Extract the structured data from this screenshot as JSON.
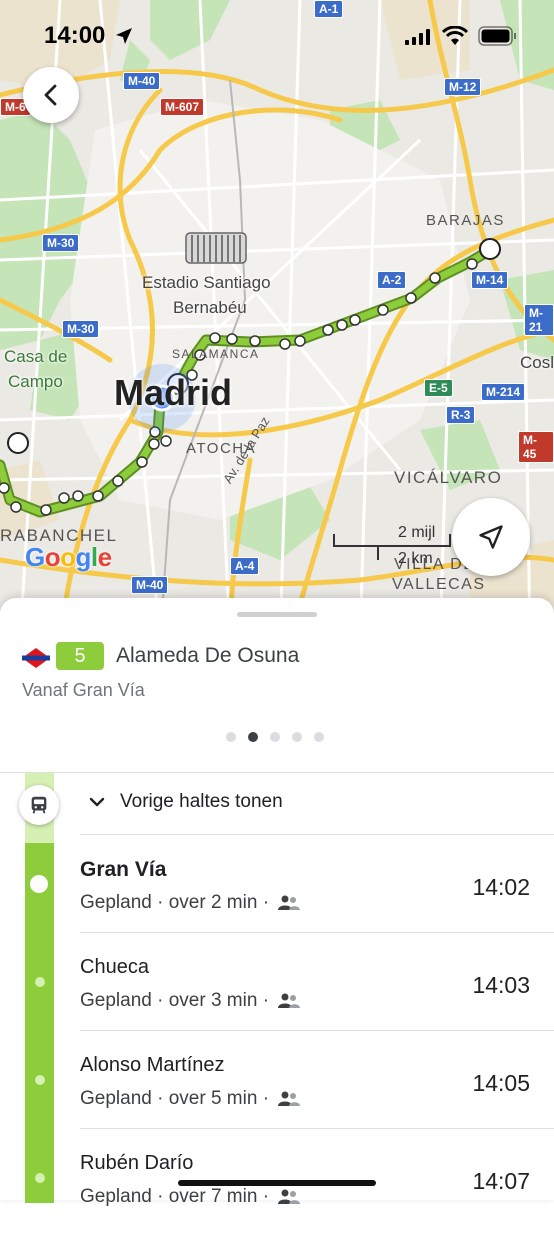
{
  "status_bar": {
    "time": "14:00"
  },
  "map": {
    "road_labels": [
      "M-40",
      "M-607",
      "M-12",
      "M-30",
      "M-30",
      "A-2",
      "M-14",
      "E-5",
      "M-214",
      "R-3",
      "M-45",
      "A-4",
      "M-40",
      "M-21",
      "A-1",
      "M-6"
    ],
    "districts": {
      "barajas": "BARAJAS",
      "salamanca": "SALAMANCA",
      "atocha": "ATOCHA",
      "vicalvaro": "VICÁLVARO",
      "carabanchel": "RABANCHEL",
      "villa_vallecas_1": "VILLA DE",
      "villa_vallecas_2": "VALLECAS"
    },
    "places": {
      "stadium_1": "Estadio Santiago",
      "stadium_2": "Bernabéu",
      "casa_campo_1": "Casa de",
      "casa_campo_2": "Campo",
      "city": "Madrid",
      "coslada": "Cosl",
      "street": "Av. de la Paz"
    },
    "scale": {
      "miles": "2 mijl",
      "km": "2 km"
    },
    "google": [
      "G",
      "o",
      "o",
      "g",
      "l",
      "e"
    ],
    "route_color": "#8dcd3b",
    "user_location_color": "#4285f4"
  },
  "sheet": {
    "line_number": "5",
    "line_color": "#8dcd3b",
    "destination": "Alameda De Osuna",
    "from": "Vanaf Gran Vía",
    "page_count": 5,
    "active_page": 2,
    "expand_label": "Vorige haltes tonen",
    "stops": [
      {
        "name": "Gran Vía",
        "status": "Gepland · over 2 min ·",
        "time": "14:02",
        "current": true
      },
      {
        "name": "Chueca",
        "status": "Gepland · over 3 min ·",
        "time": "14:03",
        "current": false
      },
      {
        "name": "Alonso Martínez",
        "status": "Gepland · over 5 min ·",
        "time": "14:05",
        "current": false
      },
      {
        "name": "Rubén Darío",
        "status": "Gepland · over 7 min ·",
        "time": "14:07",
        "current": false
      }
    ]
  }
}
